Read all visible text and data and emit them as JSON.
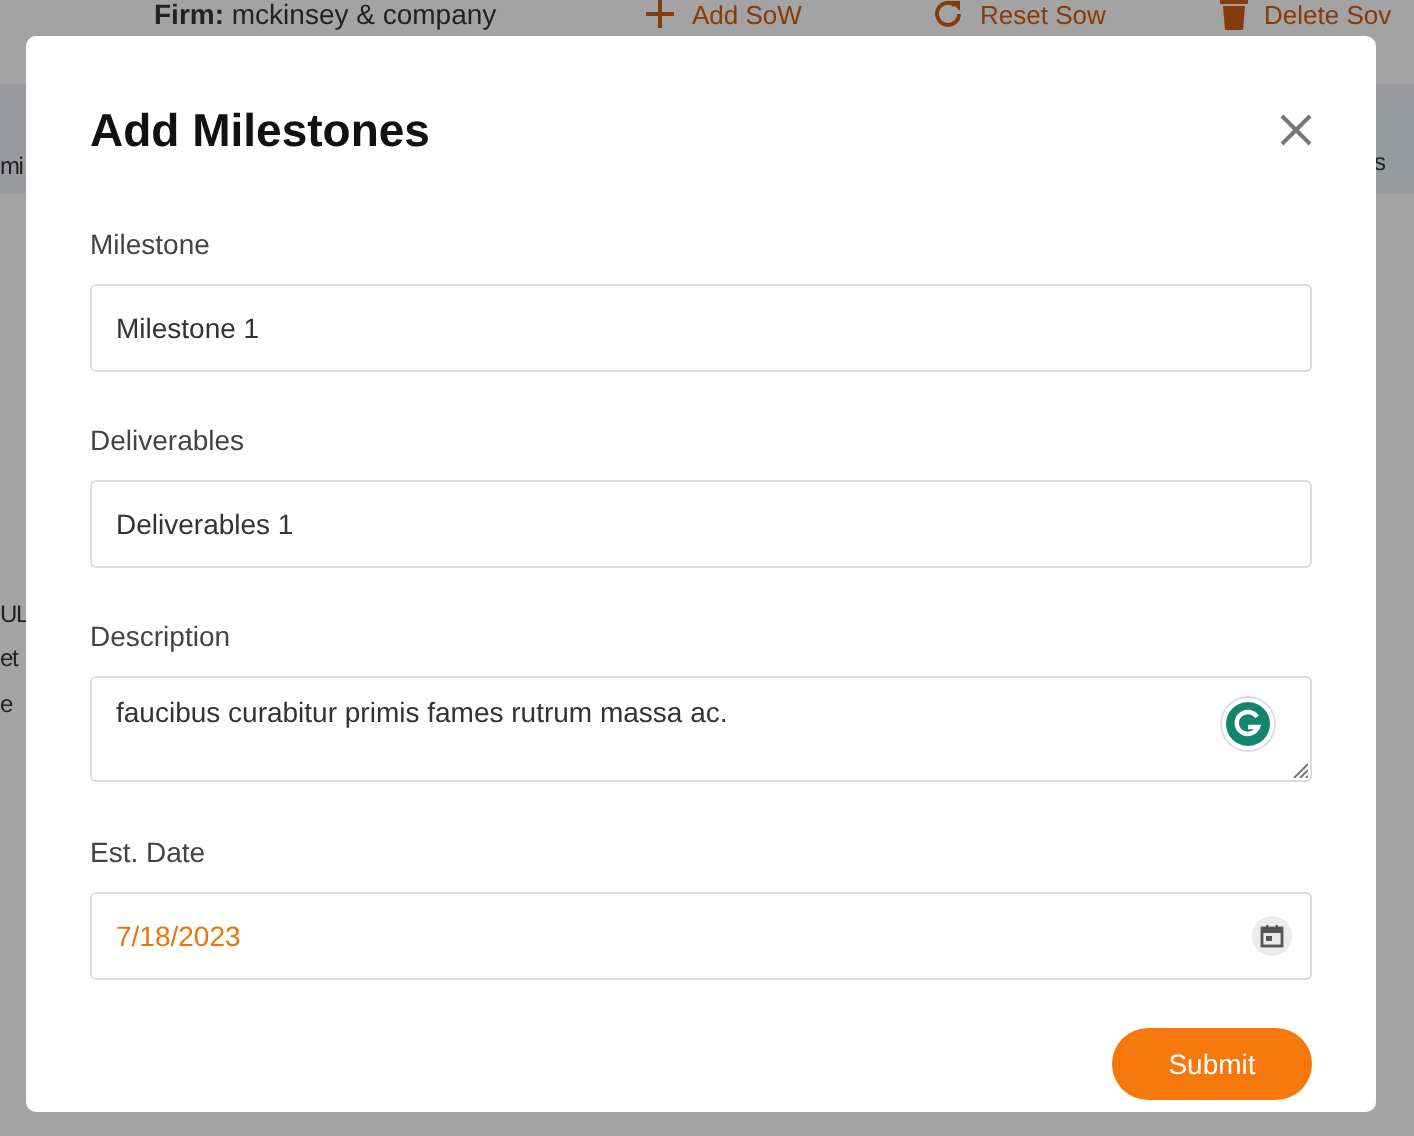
{
  "background": {
    "firm_label": "Firm:",
    "firm_name": "mckinsey & company",
    "actions": [
      {
        "kind": "add",
        "label": "Add SoW"
      },
      {
        "kind": "reset",
        "label": "Reset Sow"
      },
      {
        "kind": "delete",
        "label": "Delete Sov"
      }
    ],
    "left_fragments": [
      "mi",
      "UL",
      "et",
      "e"
    ],
    "right_fragment": "s"
  },
  "dialog": {
    "title": "Add Milestones",
    "fields": [
      {
        "kind": "text",
        "label": "Milestone",
        "value": "Milestone 1"
      },
      {
        "kind": "text",
        "label": "Deliverables",
        "value": "Deliverables 1"
      },
      {
        "kind": "textarea",
        "label": "Description",
        "value": "faucibus curabitur primis fames rutrum massa ac."
      },
      {
        "kind": "date",
        "label": "Est. Date",
        "value": "7/18/2023"
      }
    ],
    "submit": "Submit"
  }
}
